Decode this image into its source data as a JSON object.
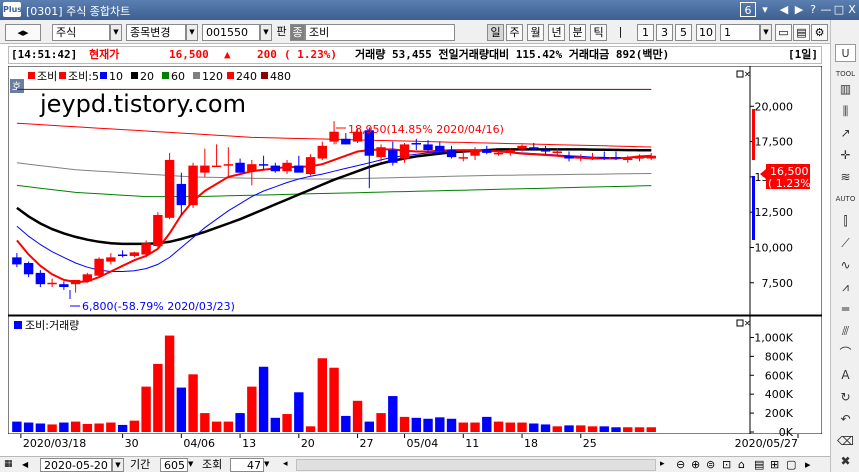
{
  "window": {
    "title": "[0301] 주식 종합차트",
    "screen_number": "6",
    "logo_text": "Plus",
    "buttons": [
      "◀",
      "▶",
      "?",
      "—",
      "□",
      "X"
    ]
  },
  "toolbar": {
    "market": "주식",
    "stock_change": "종목변경",
    "stock_code": "001550",
    "pan_label": "판",
    "jong_label": "종",
    "stock_name": "조비",
    "periods": [
      "일",
      "주",
      "월",
      "년",
      "분",
      "틱"
    ],
    "selected_period": "일",
    "numbers": [
      "1",
      "3",
      "5",
      "10"
    ],
    "count_value": "1"
  },
  "info": {
    "time": "[14:51:42]",
    "price_label": "현재가",
    "price": "16,500",
    "arrow": "▲",
    "change": "200",
    "change_pct": "( 1.23%)",
    "volume_text": "거래량 53,455 전일거래량대비 115.42% 거래대금 892(백만)",
    "period_tag": "[1일]"
  },
  "colors": {
    "up": "#ff0000",
    "down": "#0000ff",
    "ma5": "#ff0000",
    "ma10": "#0000ff",
    "ma20": "#000000",
    "ma60": "#008000",
    "ma120": "#808080",
    "ma240": "#ff0000",
    "ma480": "#8b0000"
  },
  "price_chart": {
    "badge": "호",
    "legend": [
      "조비",
      "조비:5",
      "10",
      "20",
      "60",
      "120",
      "240",
      "480"
    ],
    "watermark": "jeypd.tistory.com",
    "max_annotation": "18,950(14.85% 2020/04/16)",
    "min_annotation": "6,800(-58.79% 2020/03/23)",
    "current_price": "16,500",
    "current_pct": "( 1.23%)",
    "y_ticks": [
      "20,000",
      "17,500",
      "15,000",
      "12,500",
      "10,000",
      "7,500"
    ]
  },
  "volume_chart": {
    "legend_name": "조비:거래량",
    "y_ticks": [
      "1,000K",
      "800K",
      "600K",
      "400K",
      "200K",
      "0K"
    ]
  },
  "x_labels": [
    "2020/03/18",
    "30",
    "04/06",
    "13",
    "20",
    "27",
    "05/04",
    "11",
    "18",
    "25",
    "2020/05/27"
  ],
  "chart_data": {
    "type": "bar",
    "title": "",
    "ylim": [
      5500,
      22500
    ],
    "grid": false,
    "candles": [
      {
        "o": 9300,
        "h": 9600,
        "l": 8600,
        "c": 8800
      },
      {
        "o": 8900,
        "h": 9000,
        "l": 7900,
        "c": 8100
      },
      {
        "o": 8200,
        "h": 8400,
        "l": 7200,
        "c": 7400
      },
      {
        "o": 7500,
        "h": 7800,
        "l": 7200,
        "c": 7500
      },
      {
        "o": 7400,
        "h": 7600,
        "l": 7000,
        "c": 7200
      },
      {
        "o": 7400,
        "h": 7600,
        "l": 6800,
        "c": 7700
      },
      {
        "o": 7600,
        "h": 8200,
        "l": 7500,
        "c": 8100
      },
      {
        "o": 8000,
        "h": 9300,
        "l": 7900,
        "c": 9200
      },
      {
        "o": 9000,
        "h": 9600,
        "l": 8800,
        "c": 9300
      },
      {
        "o": 9500,
        "h": 9800,
        "l": 9300,
        "c": 9400
      },
      {
        "o": 9400,
        "h": 9700,
        "l": 9300,
        "c": 9650
      },
      {
        "o": 9500,
        "h": 10500,
        "l": 9300,
        "c": 10300
      },
      {
        "o": 10100,
        "h": 12500,
        "l": 10000,
        "c": 12300
      },
      {
        "o": 12100,
        "h": 16700,
        "l": 12000,
        "c": 16200
      },
      {
        "o": 14500,
        "h": 15300,
        "l": 12300,
        "c": 13000
      },
      {
        "o": 13000,
        "h": 16000,
        "l": 12800,
        "c": 15800
      },
      {
        "o": 15300,
        "h": 17000,
        "l": 15000,
        "c": 15800
      },
      {
        "o": 15800,
        "h": 17300,
        "l": 15800,
        "c": 15800
      },
      {
        "o": 15800,
        "h": 17100,
        "l": 14900,
        "c": 15900
      },
      {
        "o": 16000,
        "h": 16300,
        "l": 15300,
        "c": 15300
      },
      {
        "o": 15400,
        "h": 16200,
        "l": 14400,
        "c": 15900
      },
      {
        "o": 15900,
        "h": 16500,
        "l": 15500,
        "c": 15800
      },
      {
        "o": 15800,
        "h": 16000,
        "l": 15300,
        "c": 15400
      },
      {
        "o": 15400,
        "h": 16200,
        "l": 15200,
        "c": 16000
      },
      {
        "o": 15800,
        "h": 16500,
        "l": 15400,
        "c": 15300
      },
      {
        "o": 15200,
        "h": 16600,
        "l": 15100,
        "c": 16400
      },
      {
        "o": 16300,
        "h": 17500,
        "l": 16200,
        "c": 17200
      },
      {
        "o": 17500,
        "h": 18950,
        "l": 17300,
        "c": 18200
      },
      {
        "o": 17700,
        "h": 18100,
        "l": 17300,
        "c": 17300
      },
      {
        "o": 17500,
        "h": 18400,
        "l": 17400,
        "c": 18200
      },
      {
        "o": 18300,
        "h": 18500,
        "l": 14200,
        "c": 16500
      },
      {
        "o": 16400,
        "h": 17300,
        "l": 16100,
        "c": 17100
      },
      {
        "o": 16900,
        "h": 17500,
        "l": 15800,
        "c": 16000
      },
      {
        "o": 16300,
        "h": 17400,
        "l": 16000,
        "c": 17300
      },
      {
        "o": 17400,
        "h": 17700,
        "l": 16900,
        "c": 17300
      },
      {
        "o": 17300,
        "h": 17600,
        "l": 16800,
        "c": 16900
      },
      {
        "o": 17200,
        "h": 17500,
        "l": 16700,
        "c": 16800
      },
      {
        "o": 16900,
        "h": 17200,
        "l": 16300,
        "c": 16400
      },
      {
        "o": 16400,
        "h": 16900,
        "l": 16100,
        "c": 16400
      },
      {
        "o": 16500,
        "h": 17100,
        "l": 16200,
        "c": 16900
      },
      {
        "o": 16900,
        "h": 17200,
        "l": 16600,
        "c": 16700
      },
      {
        "o": 16700,
        "h": 16900,
        "l": 16500,
        "c": 16700
      },
      {
        "o": 16700,
        "h": 17000,
        "l": 16500,
        "c": 16900
      },
      {
        "o": 17000,
        "h": 17300,
        "l": 16800,
        "c": 17200
      },
      {
        "o": 17100,
        "h": 17400,
        "l": 16900,
        "c": 17000
      },
      {
        "o": 16900,
        "h": 17200,
        "l": 16600,
        "c": 16800
      },
      {
        "o": 16700,
        "h": 17000,
        "l": 16500,
        "c": 16800
      },
      {
        "o": 16500,
        "h": 16800,
        "l": 16100,
        "c": 16300
      },
      {
        "o": 16300,
        "h": 16600,
        "l": 16100,
        "c": 16400
      },
      {
        "o": 16400,
        "h": 16700,
        "l": 16200,
        "c": 16400
      },
      {
        "o": 16400,
        "h": 16800,
        "l": 16200,
        "c": 16300
      },
      {
        "o": 16400,
        "h": 16800,
        "l": 16200,
        "c": 16300
      },
      {
        "o": 16200,
        "h": 16500,
        "l": 16000,
        "c": 16300
      },
      {
        "o": 16300,
        "h": 16600,
        "l": 16100,
        "c": 16400
      },
      {
        "o": 16300,
        "h": 16700,
        "l": 16200,
        "c": 16500
      }
    ],
    "volumes": [
      110,
      100,
      90,
      80,
      100,
      110,
      85,
      90,
      100,
      75,
      120,
      480,
      720,
      1020,
      470,
      610,
      200,
      110,
      110,
      200,
      480,
      690,
      150,
      190,
      420,
      60,
      780,
      680,
      170,
      330,
      110,
      200,
      380,
      160,
      150,
      140,
      155,
      140,
      100,
      100,
      160,
      110,
      100,
      100,
      90,
      80,
      60,
      70,
      70,
      60,
      60,
      50,
      50,
      50,
      50
    ],
    "ma5": [
      10500,
      9500,
      8700,
      8100,
      7700,
      7550,
      7600,
      7900,
      8300,
      8700,
      9100,
      9400,
      9900,
      11000,
      12300,
      13300,
      14000,
      14500,
      15000,
      15200,
      15400,
      15500,
      15600,
      15700,
      15700,
      15750,
      15900,
      16200,
      16500,
      16800,
      16900,
      16950,
      16950,
      16850,
      16800,
      16800,
      16850,
      16900,
      16900,
      16900,
      16850,
      16800,
      16750,
      16650,
      16600,
      16550,
      16500,
      16400,
      16350,
      16300,
      16300,
      16300,
      16350,
      16450,
      16500
    ],
    "ma10": [
      11500,
      10800,
      10200,
      9700,
      9300,
      8900,
      8600,
      8400,
      8300,
      8300,
      8350,
      8500,
      8800,
      9300,
      10000,
      10700,
      11400,
      12000,
      12600,
      13100,
      13600,
      14000,
      14300,
      14600,
      14850,
      15050,
      15200,
      15400,
      15600,
      15800,
      16000,
      16200,
      16400,
      16500,
      16600,
      16700,
      16750,
      16800,
      16850,
      16850,
      16850,
      16800,
      16750,
      16700,
      16650,
      16600,
      16550,
      16500,
      16450,
      16400,
      16380,
      16360,
      16360,
      16380,
      16400
    ],
    "ma20": [
      12800,
      12200,
      11700,
      11300,
      11000,
      10750,
      10550,
      10400,
      10300,
      10250,
      10250,
      10250,
      10300,
      10400,
      10600,
      10850,
      11100,
      11400,
      11700,
      12000,
      12350,
      12700,
      13050,
      13400,
      13750,
      14100,
      14450,
      14800,
      15100,
      15400,
      15700,
      15950,
      16150,
      16300,
      16450,
      16550,
      16650,
      16750,
      16800,
      16850,
      16900,
      16950,
      16950,
      16950,
      16950,
      16950,
      16950,
      16950,
      16950,
      16930,
      16920,
      16910,
      16900,
      16890,
      16880
    ],
    "ma60": [
      14400,
      14300,
      14200,
      14100,
      14000,
      13900,
      13850,
      13800,
      13750,
      13700,
      13650,
      13600,
      13600,
      13600,
      13600,
      13600,
      13620,
      13640,
      13660,
      13680,
      13700,
      13720,
      13740,
      13760,
      13780,
      13800,
      13820,
      13840,
      13860,
      13880,
      13900,
      13920,
      13940,
      13960,
      13980,
      14000,
      14020,
      14040,
      14060,
      14080,
      14100,
      14120,
      14140,
      14160,
      14180,
      14200,
      14220,
      14240,
      14260,
      14280,
      14300,
      14320,
      14340,
      14360,
      14380
    ],
    "ma120": [
      16000,
      15900,
      15800,
      15700,
      15600,
      15500,
      15450,
      15400,
      15350,
      15300,
      15250,
      15200,
      15150,
      15100,
      15050,
      15000,
      14980,
      14960,
      14940,
      14920,
      14900,
      14890,
      14880,
      14870,
      14860,
      14850,
      14850,
      14860,
      14870,
      14880,
      14900,
      14920,
      14940,
      14960,
      14980,
      15000,
      15020,
      15040,
      15060,
      15080,
      15100,
      15110,
      15120,
      15130,
      15140,
      15150,
      15160,
      15170,
      15180,
      15190,
      15200,
      15210,
      15220,
      15230,
      15240
    ],
    "ma240": [
      18800,
      18750,
      18700,
      18650,
      18600,
      18550,
      18500,
      18450,
      18400,
      18350,
      18300,
      18250,
      18200,
      18150,
      18100,
      18050,
      18000,
      17950,
      17900,
      17850,
      17800,
      17780,
      17760,
      17740,
      17720,
      17700,
      17680,
      17660,
      17640,
      17620,
      17600,
      17580,
      17560,
      17540,
      17520,
      17500,
      17480,
      17460,
      17440,
      17420,
      17400,
      17380,
      17360,
      17340,
      17320,
      17300,
      17280,
      17260,
      17240,
      17220,
      17200,
      17180,
      17160,
      17140,
      17120
    ],
    "ma480": [
      21200,
      21200,
      21200,
      21200,
      21200,
      21200,
      21200,
      21200,
      21200,
      21200,
      21200,
      21200,
      21200,
      21200,
      21200,
      21200,
      21200,
      21200,
      21200,
      21200,
      21200,
      21200,
      21200,
      21200,
      21200,
      21200,
      21200,
      21200,
      21200,
      21200,
      21200,
      21200,
      21200,
      21200,
      21200,
      21200,
      21200,
      21200,
      21200,
      21200,
      21200,
      21200,
      21200,
      21200,
      21200,
      21200,
      21200,
      21200,
      21200,
      21200,
      21200,
      21200,
      21200,
      21200,
      21200
    ]
  },
  "bottom": {
    "date": "2020-05-20",
    "period_label": "기간",
    "period_value": "605",
    "lookup_label": "조회",
    "count": "47"
  },
  "rightbar": {
    "icons": [
      "U",
      "TOOL",
      "AUTO"
    ]
  }
}
